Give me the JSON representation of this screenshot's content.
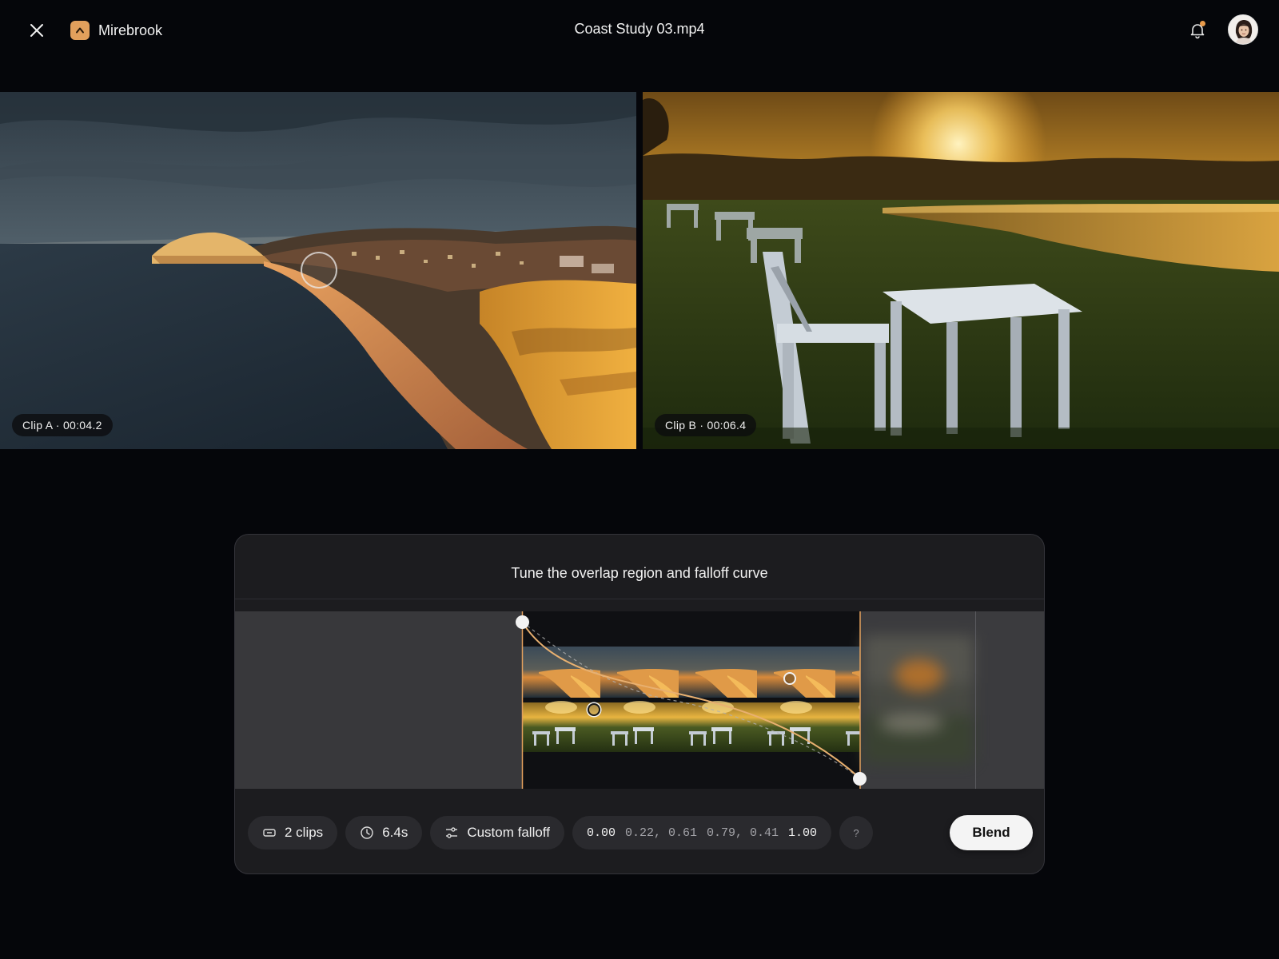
{
  "header": {
    "close_icon": "close-icon",
    "app_name": "Mirebrook",
    "file_title": "Coast Study 03.mp4",
    "notification_icon": "bell-icon",
    "avatar": "user-avatar"
  },
  "previews": {
    "clip_a_label": "Clip A · 00:04.2",
    "clip_b_label": "Clip B · 00:06.4"
  },
  "panel": {
    "title": "Tune the overlap region and falloff curve",
    "toolbar": {
      "clips_label": "2 clips",
      "duration_label": "6.4s",
      "falloff_label": "Custom falloff",
      "curve_start": "0.00",
      "curve_p1": "0.22, 0.61",
      "curve_p2": "0.79, 0.41",
      "curve_end": "1.00",
      "help_label": "?",
      "blend_label": "Blend"
    }
  },
  "colors": {
    "accent": "#e2a05c",
    "background": "#05060a",
    "panel": "#1c1c1f",
    "button": "#f4f4f4"
  }
}
